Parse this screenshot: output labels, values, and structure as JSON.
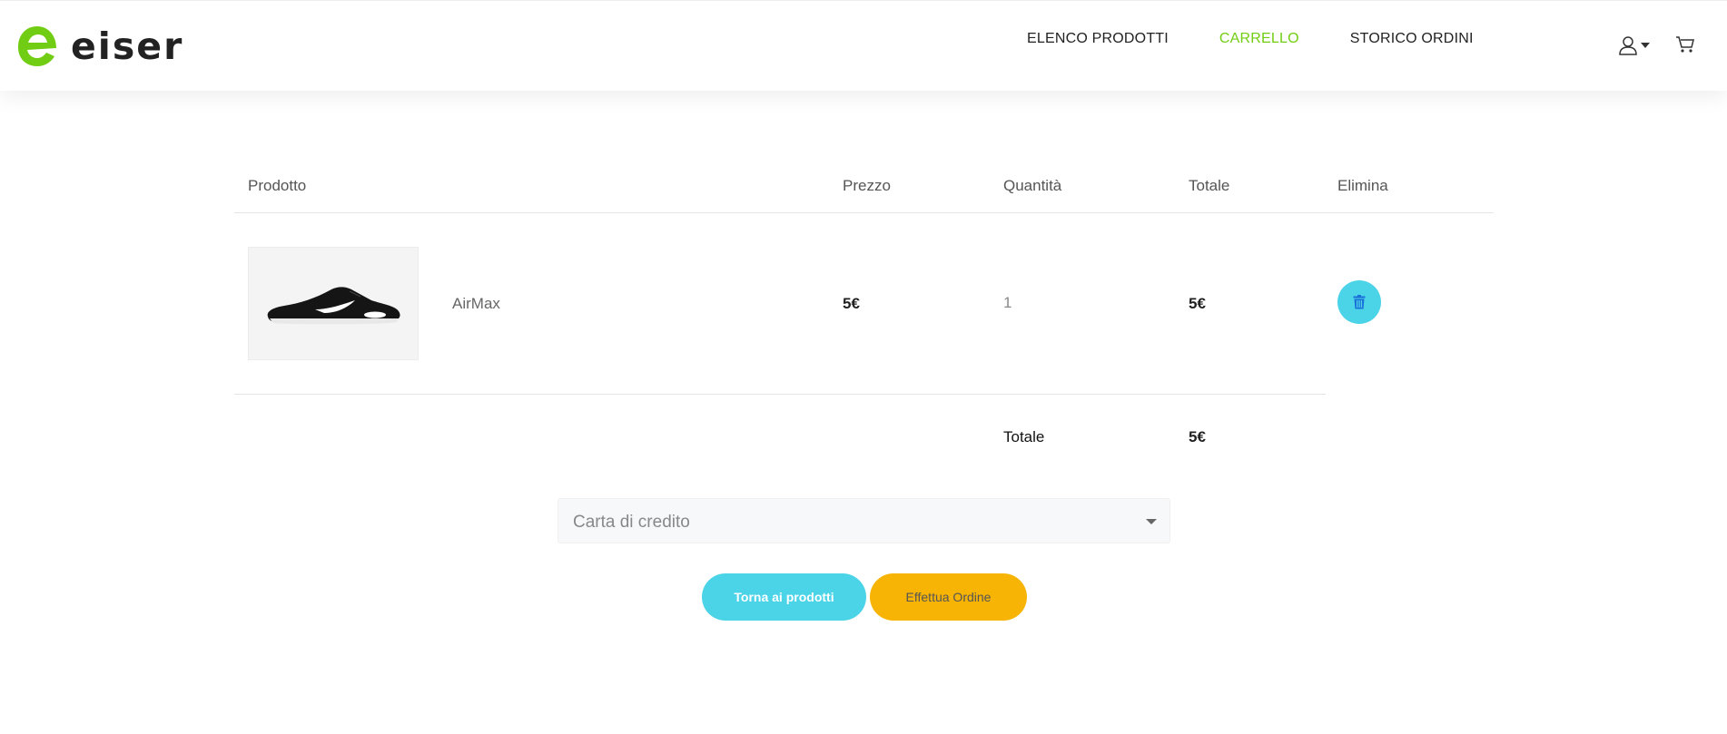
{
  "brand": {
    "name": "eiser",
    "logo_color": "#71cd14"
  },
  "nav": {
    "items": [
      {
        "label": "ELENCO PRODOTTI",
        "active": false
      },
      {
        "label": "CARRELLO",
        "active": true
      },
      {
        "label": "STORICO ORDINI",
        "active": false
      }
    ],
    "active_color": "#71cd14"
  },
  "header_icons": {
    "user": "user-icon",
    "user_dropdown": "caret-down-icon",
    "cart": "cart-icon"
  },
  "cart": {
    "columns": [
      "Prodotto",
      "Prezzo",
      "Quantità",
      "Totale",
      "Elimina"
    ],
    "items": [
      {
        "name": "AirMax",
        "price": "5€",
        "quantity": "1",
        "total": "5€",
        "image": "sneaker-image",
        "delete_icon": "trash-icon"
      }
    ],
    "summary_label": "Totale",
    "summary_value": "5€"
  },
  "payment": {
    "selected": "Carta di credito"
  },
  "actions": {
    "back_label": "Torna ai prodotti",
    "order_label": "Effettua Ordine",
    "back_color": "#4bd3e8",
    "order_color": "#f8b404"
  }
}
